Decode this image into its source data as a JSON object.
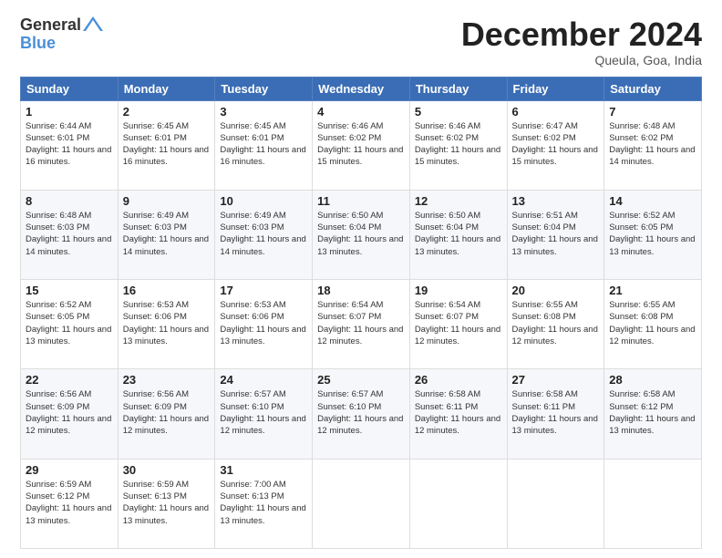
{
  "logo": {
    "general": "General",
    "blue": "Blue"
  },
  "header": {
    "month": "December 2024",
    "location": "Queula, Goa, India"
  },
  "days_of_week": [
    "Sunday",
    "Monday",
    "Tuesday",
    "Wednesday",
    "Thursday",
    "Friday",
    "Saturday"
  ],
  "weeks": [
    [
      {
        "day": 1,
        "sunrise": "6:44 AM",
        "sunset": "6:01 PM",
        "daylight": "11 hours and 16 minutes."
      },
      {
        "day": 2,
        "sunrise": "6:45 AM",
        "sunset": "6:01 PM",
        "daylight": "11 hours and 16 minutes."
      },
      {
        "day": 3,
        "sunrise": "6:45 AM",
        "sunset": "6:01 PM",
        "daylight": "11 hours and 16 minutes."
      },
      {
        "day": 4,
        "sunrise": "6:46 AM",
        "sunset": "6:02 PM",
        "daylight": "11 hours and 15 minutes."
      },
      {
        "day": 5,
        "sunrise": "6:46 AM",
        "sunset": "6:02 PM",
        "daylight": "11 hours and 15 minutes."
      },
      {
        "day": 6,
        "sunrise": "6:47 AM",
        "sunset": "6:02 PM",
        "daylight": "11 hours and 15 minutes."
      },
      {
        "day": 7,
        "sunrise": "6:48 AM",
        "sunset": "6:02 PM",
        "daylight": "11 hours and 14 minutes."
      }
    ],
    [
      {
        "day": 8,
        "sunrise": "6:48 AM",
        "sunset": "6:03 PM",
        "daylight": "11 hours and 14 minutes."
      },
      {
        "day": 9,
        "sunrise": "6:49 AM",
        "sunset": "6:03 PM",
        "daylight": "11 hours and 14 minutes."
      },
      {
        "day": 10,
        "sunrise": "6:49 AM",
        "sunset": "6:03 PM",
        "daylight": "11 hours and 14 minutes."
      },
      {
        "day": 11,
        "sunrise": "6:50 AM",
        "sunset": "6:04 PM",
        "daylight": "11 hours and 13 minutes."
      },
      {
        "day": 12,
        "sunrise": "6:50 AM",
        "sunset": "6:04 PM",
        "daylight": "11 hours and 13 minutes."
      },
      {
        "day": 13,
        "sunrise": "6:51 AM",
        "sunset": "6:04 PM",
        "daylight": "11 hours and 13 minutes."
      },
      {
        "day": 14,
        "sunrise": "6:52 AM",
        "sunset": "6:05 PM",
        "daylight": "11 hours and 13 minutes."
      }
    ],
    [
      {
        "day": 15,
        "sunrise": "6:52 AM",
        "sunset": "6:05 PM",
        "daylight": "11 hours and 13 minutes."
      },
      {
        "day": 16,
        "sunrise": "6:53 AM",
        "sunset": "6:06 PM",
        "daylight": "11 hours and 13 minutes."
      },
      {
        "day": 17,
        "sunrise": "6:53 AM",
        "sunset": "6:06 PM",
        "daylight": "11 hours and 13 minutes."
      },
      {
        "day": 18,
        "sunrise": "6:54 AM",
        "sunset": "6:07 PM",
        "daylight": "11 hours and 12 minutes."
      },
      {
        "day": 19,
        "sunrise": "6:54 AM",
        "sunset": "6:07 PM",
        "daylight": "11 hours and 12 minutes."
      },
      {
        "day": 20,
        "sunrise": "6:55 AM",
        "sunset": "6:08 PM",
        "daylight": "11 hours and 12 minutes."
      },
      {
        "day": 21,
        "sunrise": "6:55 AM",
        "sunset": "6:08 PM",
        "daylight": "11 hours and 12 minutes."
      }
    ],
    [
      {
        "day": 22,
        "sunrise": "6:56 AM",
        "sunset": "6:09 PM",
        "daylight": "11 hours and 12 minutes."
      },
      {
        "day": 23,
        "sunrise": "6:56 AM",
        "sunset": "6:09 PM",
        "daylight": "11 hours and 12 minutes."
      },
      {
        "day": 24,
        "sunrise": "6:57 AM",
        "sunset": "6:10 PM",
        "daylight": "11 hours and 12 minutes."
      },
      {
        "day": 25,
        "sunrise": "6:57 AM",
        "sunset": "6:10 PM",
        "daylight": "11 hours and 12 minutes."
      },
      {
        "day": 26,
        "sunrise": "6:58 AM",
        "sunset": "6:11 PM",
        "daylight": "11 hours and 12 minutes."
      },
      {
        "day": 27,
        "sunrise": "6:58 AM",
        "sunset": "6:11 PM",
        "daylight": "11 hours and 13 minutes."
      },
      {
        "day": 28,
        "sunrise": "6:58 AM",
        "sunset": "6:12 PM",
        "daylight": "11 hours and 13 minutes."
      }
    ],
    [
      {
        "day": 29,
        "sunrise": "6:59 AM",
        "sunset": "6:12 PM",
        "daylight": "11 hours and 13 minutes."
      },
      {
        "day": 30,
        "sunrise": "6:59 AM",
        "sunset": "6:13 PM",
        "daylight": "11 hours and 13 minutes."
      },
      {
        "day": 31,
        "sunrise": "7:00 AM",
        "sunset": "6:13 PM",
        "daylight": "11 hours and 13 minutes."
      },
      null,
      null,
      null,
      null
    ]
  ]
}
